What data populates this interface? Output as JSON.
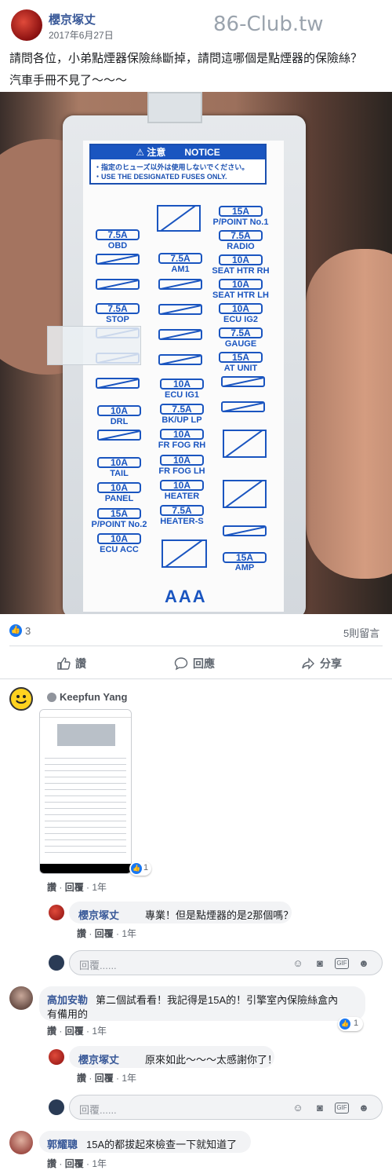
{
  "post": {
    "author": "櫻京塚丈",
    "date": "2017年6月27日",
    "watermark": "86-Club.tw",
    "text_line1": "請問各位，小弟點煙器保險絲斷掉，請問這哪個是點煙器的保險絲？",
    "text_line2": "汽車手冊不見了～～～"
  },
  "photo": {
    "notice_header": "⚠ 注意　　NOTICE",
    "notice_jp": "・指定のヒューズ以外は使用しないでください。",
    "notice_en": "・USE THE DESIGNATED FUSES ONLY.",
    "fuses": {
      "pillar_no1_amp": "15A",
      "pillar_no1_label": "P/POINT No.1",
      "radio_amp": "7.5A",
      "radio_label": "RADIO",
      "obd_amp": "7.5A",
      "obd_label": "OBD",
      "am1_amp": "7.5A",
      "am1_label": "AM1",
      "seat_rh_amp": "10A",
      "seat_rh_label": "SEAT HTR RH",
      "seat_lh_amp": "10A",
      "seat_lh_label": "SEAT HTR LH",
      "stop_amp": "7.5A",
      "stop_label": "STOP",
      "ecu_ig2_amp": "10A",
      "ecu_ig2_label": "ECU IG2",
      "gauge_amp": "7.5A",
      "gauge_label": "GAUGE",
      "at_unit_amp": "15A",
      "at_unit_label": "AT UNIT",
      "ecu_ig1_amp": "10A",
      "ecu_ig1_label": "ECU IG1",
      "drl_amp": "10A",
      "drl_label": "DRL",
      "bkup_amp": "7.5A",
      "bkup_label": "BK/UP LP",
      "fr_fog_rh_amp": "10A",
      "fr_fog_rh_label": "FR FOG RH",
      "tail_amp": "10A",
      "tail_label": "TAIL",
      "fr_fog_lh_amp": "10A",
      "fr_fog_lh_label": "FR FOG LH",
      "panel_amp": "10A",
      "panel_label": "PANEL",
      "heater_amp": "10A",
      "heater_label": "HEATER",
      "ppoint2_amp": "15A",
      "ppoint2_label": "P/POINT No.2",
      "heater_s_amp": "7.5A",
      "heater_s_label": "HEATER-S",
      "ecu_acc_amp": "10A",
      "ecu_acc_label": "ECU ACC",
      "amp_amp": "15A",
      "amp_label": "AMP"
    },
    "footer": "AAA"
  },
  "reactions": {
    "like_count": "3",
    "comment_count": "5則留言"
  },
  "actions": {
    "like": "讚",
    "comment": "回應",
    "share": "分享"
  },
  "comments": [
    {
      "author": "Keepfun Yang",
      "image_like_count": "1",
      "like": "讚",
      "reply": "回覆",
      "time": "1年",
      "replies": [
        {
          "author": "櫻京塚丈",
          "text": "專業！但是點煙器的是2那個嗎？",
          "like": "讚",
          "reply": "回覆",
          "time": "1年"
        }
      ]
    },
    {
      "author": "高加安勒",
      "text_line1": "第二個試看看！我記得是15A的！引擎室內保險絲盒內",
      "text_line2": "有備用的",
      "like_count": "1",
      "like": "讚",
      "reply": "回覆",
      "time": "1年",
      "replies": [
        {
          "author": "櫻京塚丈",
          "text": "原來如此～～～太感謝你了！",
          "like": "讚",
          "reply": "回覆",
          "time": "1年"
        }
      ]
    },
    {
      "author": "郭耀聰",
      "text": "15A的都拔起來檢查一下就知道了",
      "like": "讚",
      "reply": "回覆",
      "time": "1年"
    }
  ],
  "reply_box": {
    "placeholder": "回覆......",
    "gif": "GIF"
  },
  "colors": {
    "link": "#385898",
    "accent": "#1877f2",
    "fuse_blue": "#1a55c0"
  }
}
